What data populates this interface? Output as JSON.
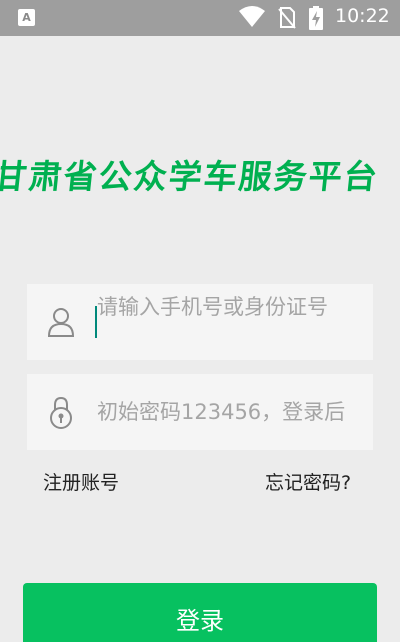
{
  "status_bar": {
    "left_icon": "A",
    "time": "10:22",
    "icons": [
      "wifi-icon",
      "no-sim-icon",
      "battery-charging-icon"
    ]
  },
  "app": {
    "title": "甘肃省公众学车服务平台",
    "accent_color": "#07c160"
  },
  "login_form": {
    "phone_placeholder": "请输入手机号或身份证号",
    "password_placeholder": "初始密码123456，登录后",
    "register_link": "注册账号",
    "forgot_link": "忘记密码?",
    "login_button": "登录"
  }
}
